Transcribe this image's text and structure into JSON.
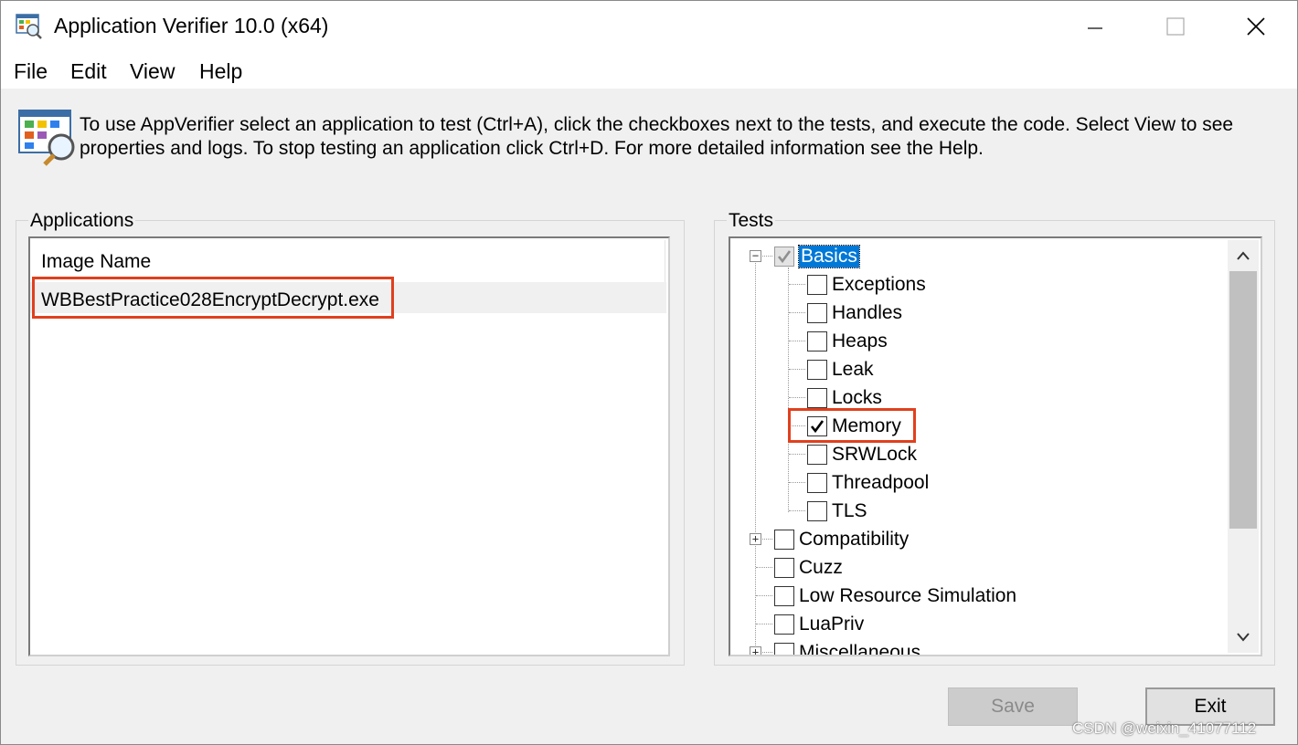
{
  "window": {
    "title": "Application Verifier 10.0 (x64)",
    "icon": "app-verifier-icon"
  },
  "menu": {
    "items": [
      "File",
      "Edit",
      "View",
      "Help"
    ]
  },
  "info": {
    "text_line1": "To use AppVerifier select an application to test (Ctrl+A), click the checkboxes next to the tests, and execute the code. Select View to see",
    "text_line2": "properties and logs. To stop testing an application click Ctrl+D. For more detailed information see the Help."
  },
  "applications": {
    "group_label": "Applications",
    "column_header": "Image Name",
    "rows": [
      "WBBestPractice028EncryptDecrypt.exe"
    ]
  },
  "tests": {
    "group_label": "Tests",
    "items": [
      {
        "label": "Basics",
        "checked": true,
        "level": 0,
        "expander": "minus",
        "selected": true
      },
      {
        "label": "Exceptions",
        "checked": false,
        "level": 1
      },
      {
        "label": "Handles",
        "checked": false,
        "level": 1
      },
      {
        "label": "Heaps",
        "checked": false,
        "level": 1
      },
      {
        "label": "Leak",
        "checked": false,
        "level": 1
      },
      {
        "label": "Locks",
        "checked": false,
        "level": 1
      },
      {
        "label": "Memory",
        "checked": true,
        "level": 1
      },
      {
        "label": "SRWLock",
        "checked": false,
        "level": 1
      },
      {
        "label": "Threadpool",
        "checked": false,
        "level": 1
      },
      {
        "label": "TLS",
        "checked": false,
        "level": 1
      },
      {
        "label": "Compatibility",
        "checked": false,
        "level": 0,
        "expander": "plus"
      },
      {
        "label": "Cuzz",
        "checked": false,
        "level": 0
      },
      {
        "label": "Low Resource Simulation",
        "checked": false,
        "level": 0
      },
      {
        "label": "LuaPriv",
        "checked": false,
        "level": 0
      },
      {
        "label": "Miscellaneous",
        "checked": false,
        "level": 0,
        "expander": "plus"
      }
    ]
  },
  "buttons": {
    "save": "Save",
    "exit": "Exit"
  },
  "watermark": "CSDN @weixin_41077112",
  "colors": {
    "highlight": "#e0401e",
    "selection": "#0078d7"
  }
}
